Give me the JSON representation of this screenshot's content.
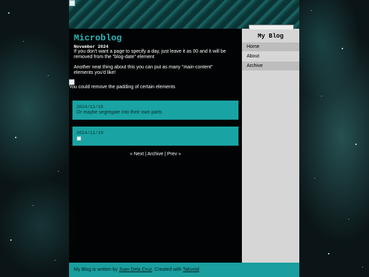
{
  "page": {
    "title": "Microblog",
    "date_heading": "November 2024",
    "intro_1": "If you don't want a page to specify a day, just leave it as 00 and it will be removed from the \"blog-date\" element",
    "intro_2": "Another neat thing about this you can put as many \"main-content\" elements you'd like!",
    "padding_note": "You could remove the padding of certain elements"
  },
  "posts": [
    {
      "date": "2024/11/18",
      "text": "Or maybe segregate into their own parts"
    },
    {
      "date": "2024/11/19",
      "text": ""
    }
  ],
  "pager": {
    "next": "« Next",
    "sep1": " | ",
    "archive": "Archive",
    "sep2": " | ",
    "prev": "Prev »"
  },
  "sidebar": {
    "title": "My Blog",
    "items": [
      {
        "label": "Home"
      },
      {
        "label": "About"
      },
      {
        "label": "Archive"
      }
    ]
  },
  "footer": {
    "prefix": "My Blog is written by ",
    "author": "Juan Dela Cruz",
    "middle": ". Created with ",
    "tool": "Tabvoid"
  },
  "colors": {
    "accent": "#1aa3a3",
    "title": "#2ab7b7",
    "sidebar_bg": "#d6d6d6",
    "sidebar_alt": "#bdbdbd"
  }
}
